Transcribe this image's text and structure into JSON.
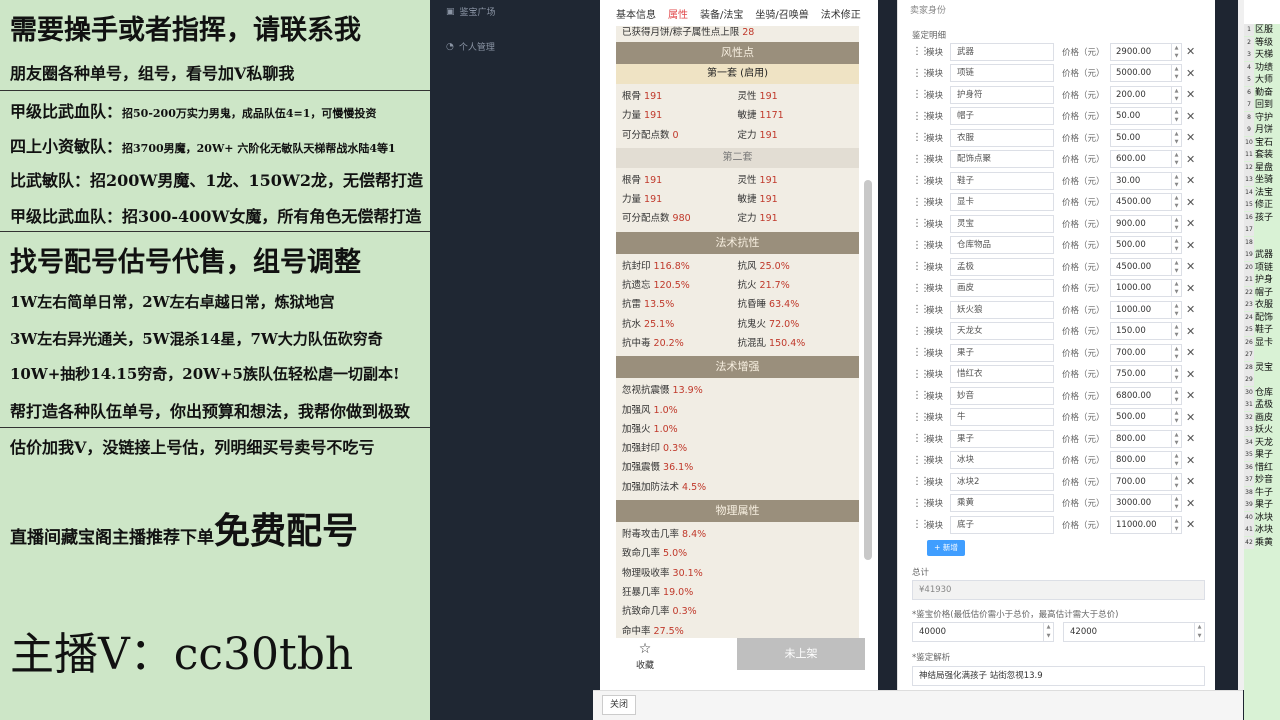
{
  "promo": {
    "line1": "需要操手或者指挥，请联系我",
    "line2": "朋友圈各种单号，组号，看号加V私聊我",
    "line3_head": "甲级比武血队：",
    "line3_body": "招50-200万实力男鬼，成品队伍4=1，可慢慢投资",
    "line4_head": "四上小资敏队：",
    "line4_body": "招3700男魔，20W+ 六阶化无敏队天梯帮战水陆4等1",
    "line5": "比武敏队：招200W男魔、1龙、150W2龙，无偿帮打造",
    "line6": "甲级比武血队：招300-400W女魔，所有角色无偿帮打造",
    "line7": "找号配号估号代售，组号调整",
    "line8": "1W左右简单日常，2W左右卓越日常，炼狱地宫",
    "line9": "3W左右异光通关，5W混杀14星，7W大力队伍砍穷奇",
    "line10": "10W+抽秒14.15穷奇，20W+5族队伍轻松虐一切副本!",
    "line11": "帮打造各种队伍单号，你出预算和想法，我帮你做到极致",
    "line12": "估价加我V，没链接上号估，列明细买号卖号不吃亏",
    "line13_small": "直播间藏宝阁主播推荐下单",
    "line13_big": "免费配号",
    "line14": "主播V：cc30tbh"
  },
  "sidebar": {
    "items": [
      {
        "label": "鉴宝广场",
        "icon": "market-icon"
      },
      {
        "label": "个人管理",
        "icon": "user-icon"
      }
    ]
  },
  "detail": {
    "tabs": [
      "基本信息",
      "属性",
      "装备/法宝",
      "坐骑/召唤兽",
      "法术修正"
    ],
    "active_tab": 1,
    "top_note_text": "已获得月饼/粽子属性点上限",
    "top_note_value": "28",
    "sections": {
      "fengxing": "风性点",
      "set1": "第一套 (启用)",
      "set2": "第二套",
      "resist": "法术抗性",
      "enhance": "法术增强",
      "physical": "物理属性"
    },
    "set1": [
      {
        "k": "根骨",
        "v": "191"
      },
      {
        "k": "灵性",
        "v": "191"
      },
      {
        "k": "力量",
        "v": "191"
      },
      {
        "k": "敏捷",
        "v": "1171"
      },
      {
        "k": "可分配点数",
        "v": "0"
      },
      {
        "k": "定力",
        "v": "191"
      }
    ],
    "set2": [
      {
        "k": "根骨",
        "v": "191"
      },
      {
        "k": "灵性",
        "v": "191"
      },
      {
        "k": "力量",
        "v": "191"
      },
      {
        "k": "敏捷",
        "v": "191"
      },
      {
        "k": "可分配点数",
        "v": "980"
      },
      {
        "k": "定力",
        "v": "191"
      }
    ],
    "resist": [
      {
        "k": "抗封印",
        "v": "116.8%"
      },
      {
        "k": "抗风",
        "v": "25.0%"
      },
      {
        "k": "抗遗忘",
        "v": "120.5%"
      },
      {
        "k": "抗火",
        "v": "21.7%"
      },
      {
        "k": "抗雷",
        "v": "13.5%"
      },
      {
        "k": "抗昏睡",
        "v": "63.4%"
      },
      {
        "k": "抗水",
        "v": "25.1%"
      },
      {
        "k": "抗鬼火",
        "v": "72.0%"
      },
      {
        "k": "抗中毒",
        "v": "20.2%"
      },
      {
        "k": "抗混乱",
        "v": "150.4%"
      }
    ],
    "enhance": [
      {
        "k": "忽视抗震慑",
        "v": "13.9%"
      },
      {
        "k": "加强风",
        "v": "1.0%"
      },
      {
        "k": "加强火",
        "v": "1.0%"
      },
      {
        "k": "加强封印",
        "v": "0.3%"
      },
      {
        "k": "加强震慑",
        "v": "36.1%"
      },
      {
        "k": "加强加防法术",
        "v": "4.5%"
      }
    ],
    "physical": [
      {
        "k": "附毒攻击几率",
        "v": "8.4%"
      },
      {
        "k": "致命几率",
        "v": "5.0%"
      },
      {
        "k": "物理吸收率",
        "v": "30.1%"
      },
      {
        "k": "狂暴几率",
        "v": "19.0%"
      },
      {
        "k": "抗致命几率",
        "v": "0.3%"
      },
      {
        "k": "命中率",
        "v": "27.5%"
      }
    ],
    "favorite_label": "收藏",
    "list_button": "未上架"
  },
  "bottombar": {
    "close_label": "关闭"
  },
  "seller": {
    "title": "卖家身份",
    "detail_label": "鉴定明细",
    "tag": "模块",
    "price_label": "价格（元）",
    "items": [
      {
        "name": "武器",
        "price": "2900.00"
      },
      {
        "name": "项链",
        "price": "5000.00"
      },
      {
        "name": "护身符",
        "price": "200.00"
      },
      {
        "name": "帽子",
        "price": "50.00"
      },
      {
        "name": "衣服",
        "price": "50.00"
      },
      {
        "name": "配饰点聚",
        "price": "600.00"
      },
      {
        "name": "鞋子",
        "price": "30.00"
      },
      {
        "name": "显卡",
        "price": "4500.00"
      },
      {
        "name": "灵宝",
        "price": "900.00"
      },
      {
        "name": "仓库物品",
        "price": "500.00"
      },
      {
        "name": "孟极",
        "price": "4500.00"
      },
      {
        "name": "画皮",
        "price": "1000.00"
      },
      {
        "name": "妖火狼",
        "price": "1000.00"
      },
      {
        "name": "天龙女",
        "price": "150.00"
      },
      {
        "name": "果子",
        "price": "700.00"
      },
      {
        "name": "惜红衣",
        "price": "750.00"
      },
      {
        "name": "妙音",
        "price": "6800.00"
      },
      {
        "name": "牛",
        "price": "500.00"
      },
      {
        "name": "果子",
        "price": "800.00"
      },
      {
        "name": "冰块",
        "price": "800.00"
      },
      {
        "name": "冰块2",
        "price": "700.00"
      },
      {
        "name": "乘黄",
        "price": "3000.00"
      },
      {
        "name": "底子",
        "price": "11000.00"
      }
    ],
    "add_label": "+ 新增",
    "total_label": "总计",
    "total_value": "¥41930",
    "range_label": "*鉴宝价格(最低估价需小于总价，最高估计需大于总价)",
    "range_min": "40000",
    "range_max": "42000",
    "analysis_label": "*鉴定解析",
    "analysis_text": "神结局强化满孩子 站街忽视13.9"
  },
  "sheet": {
    "rows": [
      {
        "n": "1",
        "t": "区服"
      },
      {
        "n": "2",
        "t": "等级"
      },
      {
        "n": "3",
        "t": "天梯"
      },
      {
        "n": "4",
        "t": "功绩"
      },
      {
        "n": "5",
        "t": "大师"
      },
      {
        "n": "6",
        "t": "勤奋"
      },
      {
        "n": "7",
        "t": "回到"
      },
      {
        "n": "8",
        "t": "守护"
      },
      {
        "n": "9",
        "t": "月饼"
      },
      {
        "n": "10",
        "t": "宝石"
      },
      {
        "n": "11",
        "t": "套装"
      },
      {
        "n": "12",
        "t": "星盘"
      },
      {
        "n": "13",
        "t": "坐骑"
      },
      {
        "n": "14",
        "t": "法宝"
      },
      {
        "n": "15",
        "t": "修正"
      },
      {
        "n": "16",
        "t": "孩子"
      },
      {
        "n": "17",
        "t": ""
      },
      {
        "n": "18",
        "t": ""
      },
      {
        "n": "19",
        "t": "武器"
      },
      {
        "n": "20",
        "t": "项链"
      },
      {
        "n": "21",
        "t": "护身"
      },
      {
        "n": "22",
        "t": "帽子"
      },
      {
        "n": "23",
        "t": "衣服"
      },
      {
        "n": "24",
        "t": "配饰"
      },
      {
        "n": "25",
        "t": "鞋子"
      },
      {
        "n": "26",
        "t": "显卡"
      },
      {
        "n": "27",
        "t": ""
      },
      {
        "n": "28",
        "t": "灵宝"
      },
      {
        "n": "29",
        "t": ""
      },
      {
        "n": "30",
        "t": "仓库"
      },
      {
        "n": "31",
        "t": "孟极"
      },
      {
        "n": "32",
        "t": "画皮"
      },
      {
        "n": "33",
        "t": "妖火"
      },
      {
        "n": "34",
        "t": "天龙"
      },
      {
        "n": "35",
        "t": "果子"
      },
      {
        "n": "36",
        "t": "惜红"
      },
      {
        "n": "37",
        "t": "妙音"
      },
      {
        "n": "38",
        "t": "牛子"
      },
      {
        "n": "39",
        "t": "果子"
      },
      {
        "n": "40",
        "t": "冰块"
      },
      {
        "n": "41",
        "t": "冰块"
      },
      {
        "n": "42",
        "t": "乘黄"
      }
    ]
  }
}
